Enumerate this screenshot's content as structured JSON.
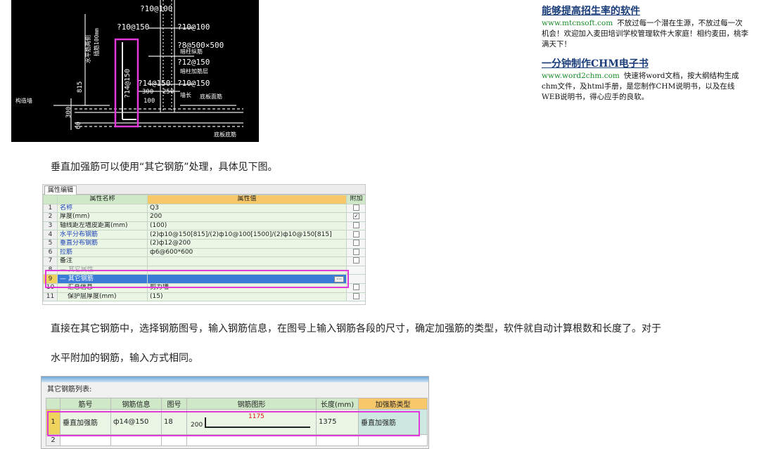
{
  "cad": {
    "labels": [
      "?10@100",
      "?10@100",
      "?8@500×500",
      "?12@150",
      "?10@150",
      "?10@150",
      "?14@150",
      "815",
      "300",
      "250",
      "100",
      "300",
      "60",
      "底板面筋",
      "底板底筋",
      "墙长",
      "暗柱纵筋",
      "构造墙",
      "水平筋两侧",
      "插筋100mm",
      "暗柱加筋层"
    ]
  },
  "ads": [
    {
      "title": "能够提高招生率的软件",
      "url": "www.mtcnsoft.com",
      "text": "不放过每一个潜在生源，不放过每一次机会！欢迎加入麦田培训学校管理软件大家庭！相约麦田，桃李满天下！"
    },
    {
      "title": "一分钟制作CHM电子书",
      "url": "www.word2chm.com",
      "text": "快速将word文档，按大纲结构生成chm文件，及html手册，是您制作CHM说明书，以及在线WEB说明书，得心应手的良软。"
    }
  ],
  "paragraphs": {
    "p1": "垂直加强筋可以使用“其它钢筋”处理，具体见下图。",
    "p2": "直接在其它钢筋中，选择钢筋图号，输入钢筋信息，在图号上输入钢筋各段的尺寸，确定加强筋的类型，软件就自动计算根数和长度了。对于",
    "p3": "水平附加的钢筋，输入方式相同。"
  },
  "property_editor": {
    "tab": "属性编辑",
    "headers": {
      "name": "属性名称",
      "value": "属性值",
      "extra": "附加"
    },
    "rows": [
      {
        "num": "1",
        "name": "名称",
        "value": "Q3",
        "checked": ""
      },
      {
        "num": "2",
        "name": "厚度(mm)",
        "value": "200",
        "checked": "✓"
      },
      {
        "num": "3",
        "name": "轴线距左墙皮距离(mm)",
        "value": "(100)",
        "checked": ""
      },
      {
        "num": "4",
        "name": "水平分布钢筋",
        "value": "(2)ф10@150[815]/(2)ф10@100[1500]/(2)ф10@150[815]",
        "checked": ""
      },
      {
        "num": "5",
        "name": "垂直分布钢筋",
        "value": "(2)ф12@200",
        "checked": ""
      },
      {
        "num": "6",
        "name": "拉筋",
        "value": "ф6@600*600",
        "checked": ""
      },
      {
        "num": "7",
        "name": "备注",
        "value": "",
        "checked": ""
      },
      {
        "num": "8",
        "name": "— 其它属性",
        "value": "",
        "checked": ""
      },
      {
        "num": "9",
        "name": "— 其它钢筋",
        "value": "",
        "checked": ""
      },
      {
        "num": "10",
        "name": "汇总信息",
        "value": "剪力墙",
        "checked": ""
      },
      {
        "num": "11",
        "name": "保护层厚度(mm)",
        "value": "(15)",
        "checked": ""
      }
    ],
    "ellipsis": "···"
  },
  "rebar_list": {
    "title": "其它钢筋列表:",
    "headers": [
      "筋号",
      "钢筋信息",
      "图号",
      "钢筋图形",
      "长度(mm)",
      "加强筋类型"
    ],
    "rows": [
      {
        "num": "1",
        "name": "垂直加强筋",
        "info": "ф14@150",
        "fig": "18",
        "shape_left": "200",
        "shape_mid": "1175",
        "length": "1375",
        "type": "垂直加强筋"
      }
    ],
    "empty_row_num": "2",
    "accent_highlight": "#e03ad8"
  }
}
